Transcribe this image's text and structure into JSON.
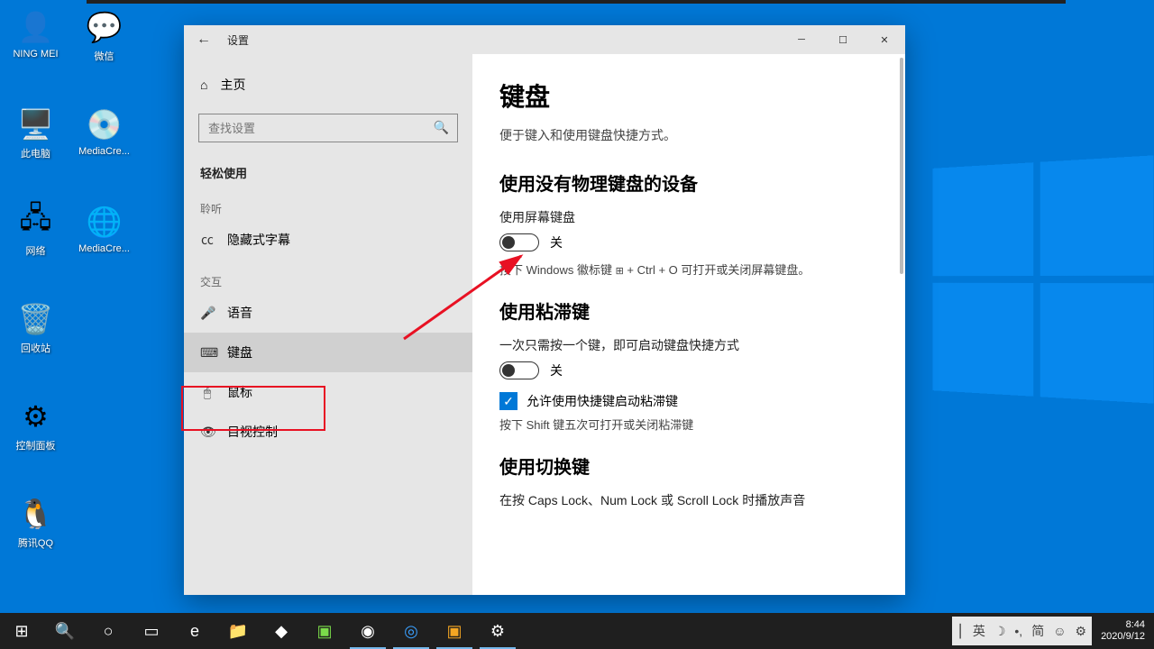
{
  "desktop": {
    "icons": [
      {
        "label": "NING MEI",
        "glyph": "👤"
      },
      {
        "label": "微信",
        "glyph": "💬"
      },
      {
        "label": "此电脑",
        "glyph": "🖥️"
      },
      {
        "label": "MediaCre...",
        "glyph": "💿"
      },
      {
        "label": "网络",
        "glyph": "🖧"
      },
      {
        "label": "MediaCre...",
        "glyph": "🌐"
      },
      {
        "label": "回收站",
        "glyph": "🗑️"
      },
      {
        "label": "控制面板",
        "glyph": "⚙"
      },
      {
        "label": "腾讯QQ",
        "glyph": "🐧"
      }
    ]
  },
  "settings": {
    "app_title": "设置",
    "home": "主页",
    "search_placeholder": "查找设置",
    "section": "轻松使用",
    "cat_listen": "聆听",
    "cat_interact": "交互",
    "items": {
      "cc": "隐藏式字幕",
      "voice": "语音",
      "keyboard": "键盘",
      "mouse": "鼠标",
      "eye": "目视控制"
    },
    "content": {
      "h1": "键盘",
      "sub": "便于键入和使用键盘快捷方式。",
      "h2a": "使用没有物理键盘的设备",
      "lbl_osk": "使用屏幕键盘",
      "state_off": "关",
      "hint_osk_a": "按下 Windows 徽标键 ",
      "hint_osk_b": " + Ctrl + O 可打开或关闭屏幕键盘。",
      "h2b": "使用粘滞键",
      "lbl_sticky": "一次只需按一个键，即可启动键盘快捷方式",
      "chk_sticky": "允许使用快捷键启动粘滞键",
      "hint_sticky": "按下 Shift 键五次可打开或关闭粘滞键",
      "h2c": "使用切换键",
      "lbl_toggle": "在按 Caps Lock、Num Lock 或 Scroll Lock 时播放声音"
    }
  },
  "tray": {
    "ime": "英",
    "simp": "简",
    "time": "8:44",
    "date": "2020/9/12"
  }
}
